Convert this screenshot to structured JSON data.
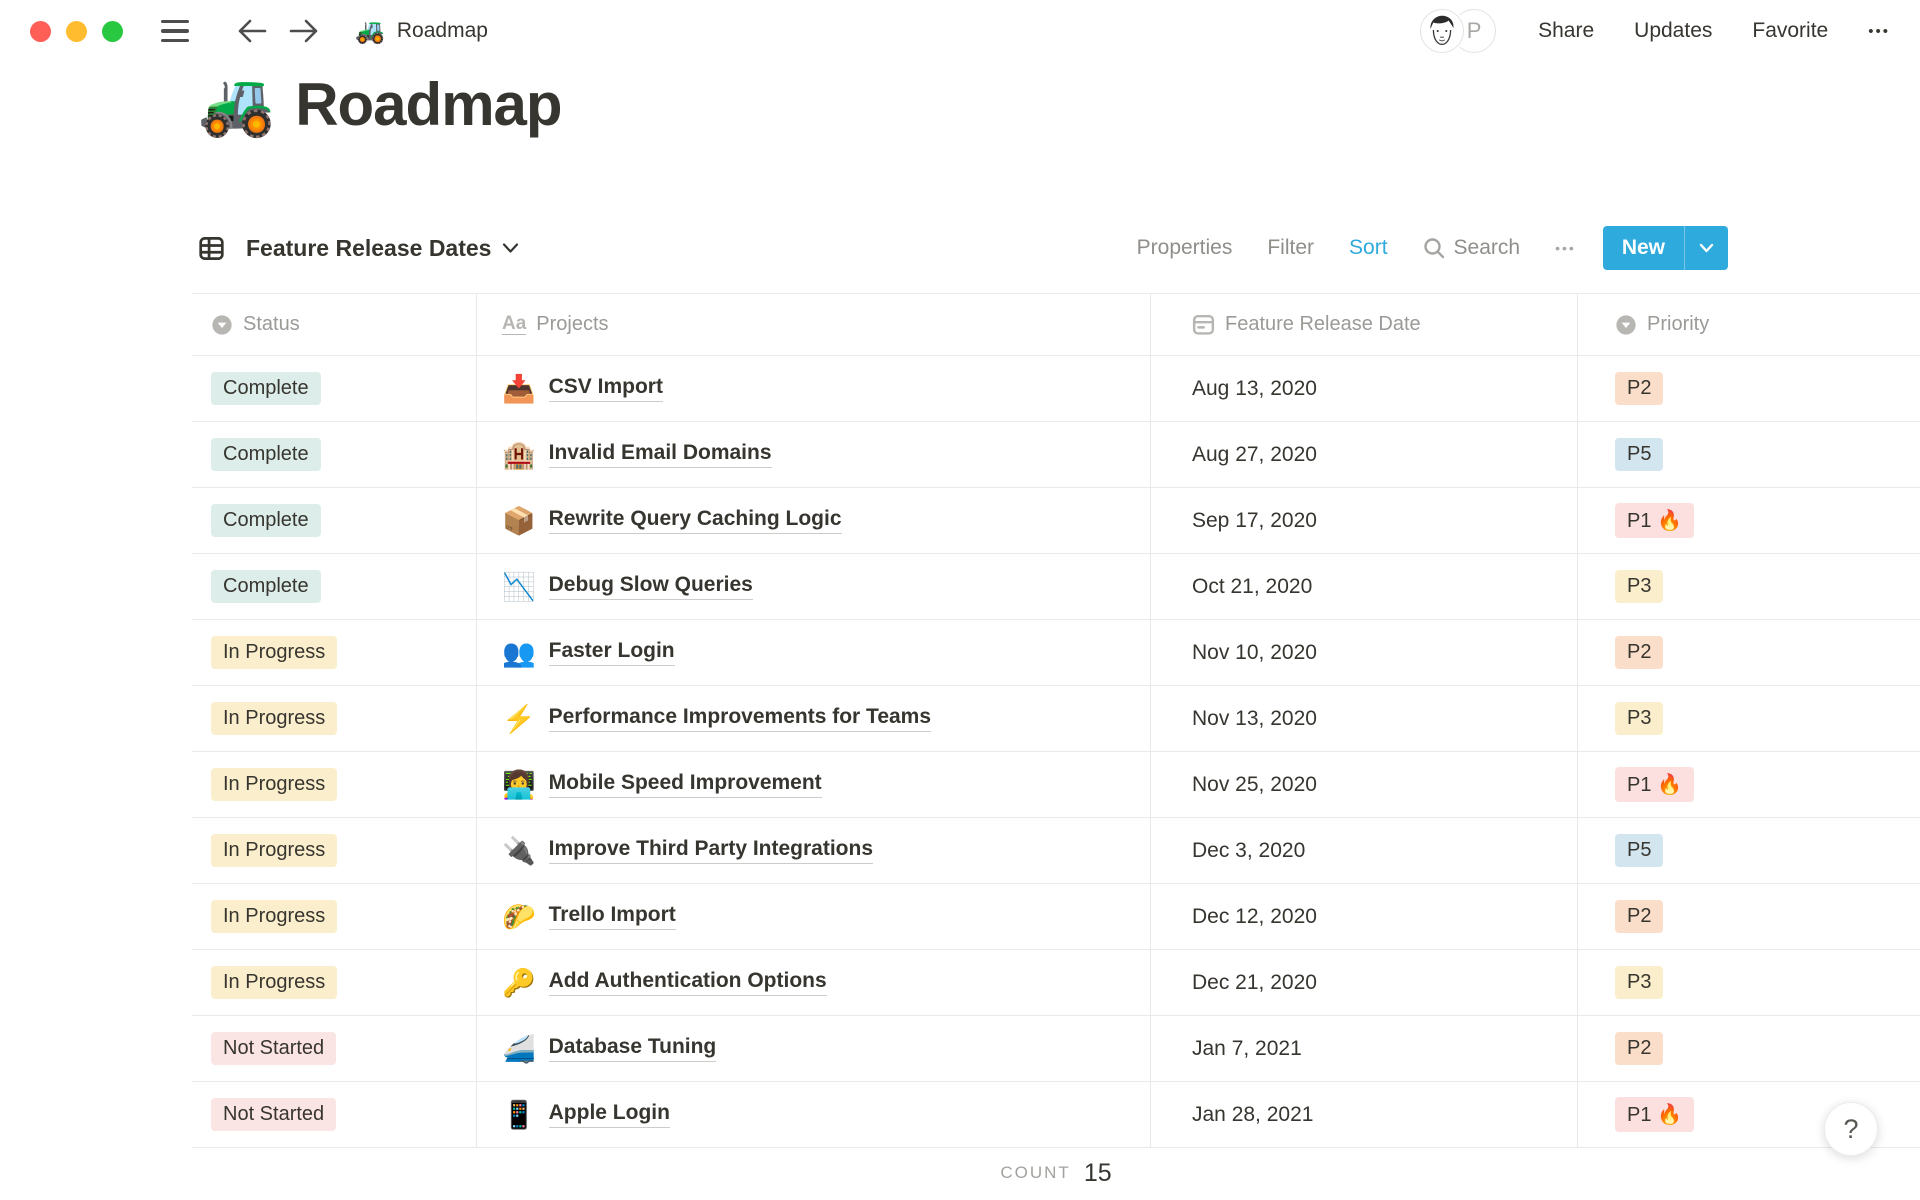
{
  "topbar": {
    "document_emoji": "🚜",
    "document_title": "Roadmap",
    "avatar_initial": "P",
    "share_label": "Share",
    "updates_label": "Updates",
    "favorite_label": "Favorite",
    "more_label": "•••"
  },
  "page": {
    "emoji": "🚜",
    "title": "Roadmap"
  },
  "view_bar": {
    "view_name": "Feature Release Dates",
    "properties_label": "Properties",
    "filter_label": "Filter",
    "sort_label": "Sort",
    "search_label": "Search",
    "more_label": "•••",
    "new_label": "New",
    "accent_color": "#2EAADC"
  },
  "table": {
    "columns": [
      {
        "label": "Status",
        "type": "select"
      },
      {
        "label": "Projects",
        "type": "title"
      },
      {
        "label": "Feature Release Date",
        "type": "date"
      },
      {
        "label": "Priority",
        "type": "select"
      }
    ],
    "status_colors": {
      "Complete": "#DDEDEA",
      "In Progress": "#FBEECC",
      "Not Started": "#FBE4E4"
    },
    "priority_colors": {
      "P1 🔥": "#FBE0DF",
      "P2": "#FADEC9",
      "P3": "#FBEECC",
      "P5": "#D3E5EF"
    },
    "rows": [
      {
        "status": "Complete",
        "emoji": "📥",
        "project": "CSV Import",
        "date": "Aug 13, 2020",
        "priority": "P2"
      },
      {
        "status": "Complete",
        "emoji": "🏨",
        "project": "Invalid Email Domains",
        "date": "Aug 27, 2020",
        "priority": "P5"
      },
      {
        "status": "Complete",
        "emoji": "📦",
        "project": "Rewrite Query Caching Logic",
        "date": "Sep 17, 2020",
        "priority": "P1 🔥"
      },
      {
        "status": "Complete",
        "emoji": "📉",
        "project": "Debug Slow Queries",
        "date": "Oct 21, 2020",
        "priority": "P3"
      },
      {
        "status": "In Progress",
        "emoji": "👥",
        "project": "Faster Login",
        "date": "Nov 10, 2020",
        "priority": "P2"
      },
      {
        "status": "In Progress",
        "emoji": "⚡",
        "project": "Performance Improvements for Teams",
        "date": "Nov 13, 2020",
        "priority": "P3"
      },
      {
        "status": "In Progress",
        "emoji": "👩‍💻",
        "project": "Mobile Speed Improvement",
        "date": "Nov 25, 2020",
        "priority": "P1 🔥"
      },
      {
        "status": "In Progress",
        "emoji": "🔌",
        "project": "Improve Third Party Integrations",
        "date": "Dec 3, 2020",
        "priority": "P5"
      },
      {
        "status": "In Progress",
        "emoji": "🌮",
        "project": "Trello Import",
        "date": "Dec 12, 2020",
        "priority": "P2"
      },
      {
        "status": "In Progress",
        "emoji": "🔑",
        "project": "Add Authentication Options",
        "date": "Dec 21, 2020",
        "priority": "P3"
      },
      {
        "status": "Not Started",
        "emoji": "🚄",
        "project": "Database Tuning",
        "date": "Jan 7, 2021",
        "priority": "P2"
      },
      {
        "status": "Not Started",
        "emoji": "📱",
        "project": "Apple Login",
        "date": "Jan 28, 2021",
        "priority": "P1 🔥"
      }
    ]
  },
  "footer": {
    "count_label": "COUNT",
    "count_value": "15",
    "help_label": "?"
  },
  "window": {
    "traffic_red": "#FF5F57",
    "traffic_yellow": "#FEBC2E",
    "traffic_green": "#28C840"
  }
}
